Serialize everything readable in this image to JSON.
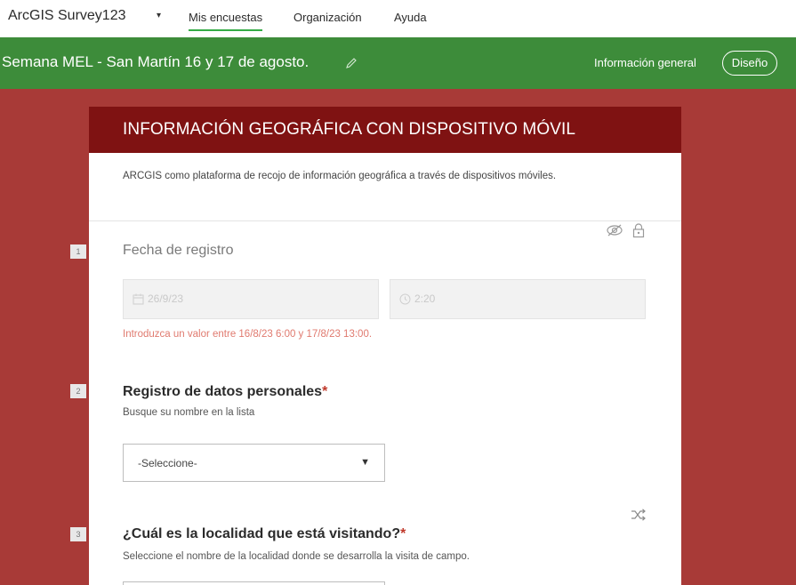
{
  "app": {
    "title": "ArcGIS Survey123",
    "caret": "▾",
    "nav": [
      "Mis encuestas",
      "Organización",
      "Ayuda"
    ]
  },
  "header": {
    "survey_title": "Semana MEL - San Martín 16 y 17 de agosto.",
    "info_link": "Información general",
    "design_button": "Diseño"
  },
  "form": {
    "title": "INFORMACIÓN GEOGRÁFICA CON DISPOSITIVO MÓVIL",
    "description": "ARCGIS como plataforma de recojo de información geográfica a través de dispositivos móviles.",
    "questions": [
      {
        "number": "1",
        "title": "Fecha de registro",
        "date_value": "26/9/23",
        "time_value": "2:20",
        "error": "Introduzca un valor entre 16/8/23 6:00 y 17/8/23 13:00."
      },
      {
        "number": "2",
        "title": "Registro de datos personales",
        "required_mark": "*",
        "hint": "Busque su nombre en la lista",
        "select_value": "-Seleccione-",
        "select_arrow": "▼"
      },
      {
        "number": "3",
        "title": "¿Cuál es la localidad que está visitando?",
        "required_mark": "*",
        "hint": "Seleccione el nombre de la localidad donde se desarrolla la visita de campo."
      }
    ]
  },
  "colors": {
    "brand_green": "#3d8c3a",
    "nav_active": "#35ac46",
    "page_bg": "#a83a37",
    "card_header": "#7f1212",
    "required": "#c0392b",
    "error_text": "#e07a6f"
  },
  "icons": [
    "pencil-icon",
    "hidden-eye-icon",
    "lock-icon",
    "calendar-icon",
    "clock-icon",
    "shuffle-icon",
    "dropdown-arrow-icon"
  ]
}
